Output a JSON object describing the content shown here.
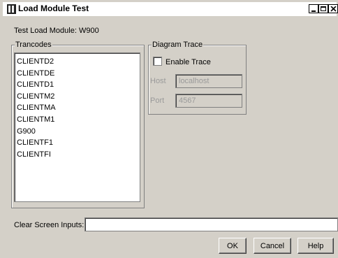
{
  "window": {
    "title": "Load Module Test"
  },
  "module": {
    "label": "Test Load Module:",
    "value": "W900"
  },
  "trancodes": {
    "title": "Trancodes",
    "items": [
      "CLIENTD2",
      "CLIENTDE",
      "CLIENTD1",
      "CLIENTM2",
      "CLIENTMA",
      "CLIENTM1",
      "G900",
      "CLIENTF1",
      "CLIENTFI"
    ]
  },
  "diagram": {
    "title": "Diagram Trace",
    "enable_label": "Enable Trace",
    "enable_checked": false,
    "host_label": "Host",
    "host_value": "localhost",
    "port_label": "Port",
    "port_value": "4567"
  },
  "clear": {
    "label": "Clear Screen Inputs:",
    "value": ""
  },
  "buttons": {
    "ok": "OK",
    "cancel": "Cancel",
    "help": "Help"
  }
}
